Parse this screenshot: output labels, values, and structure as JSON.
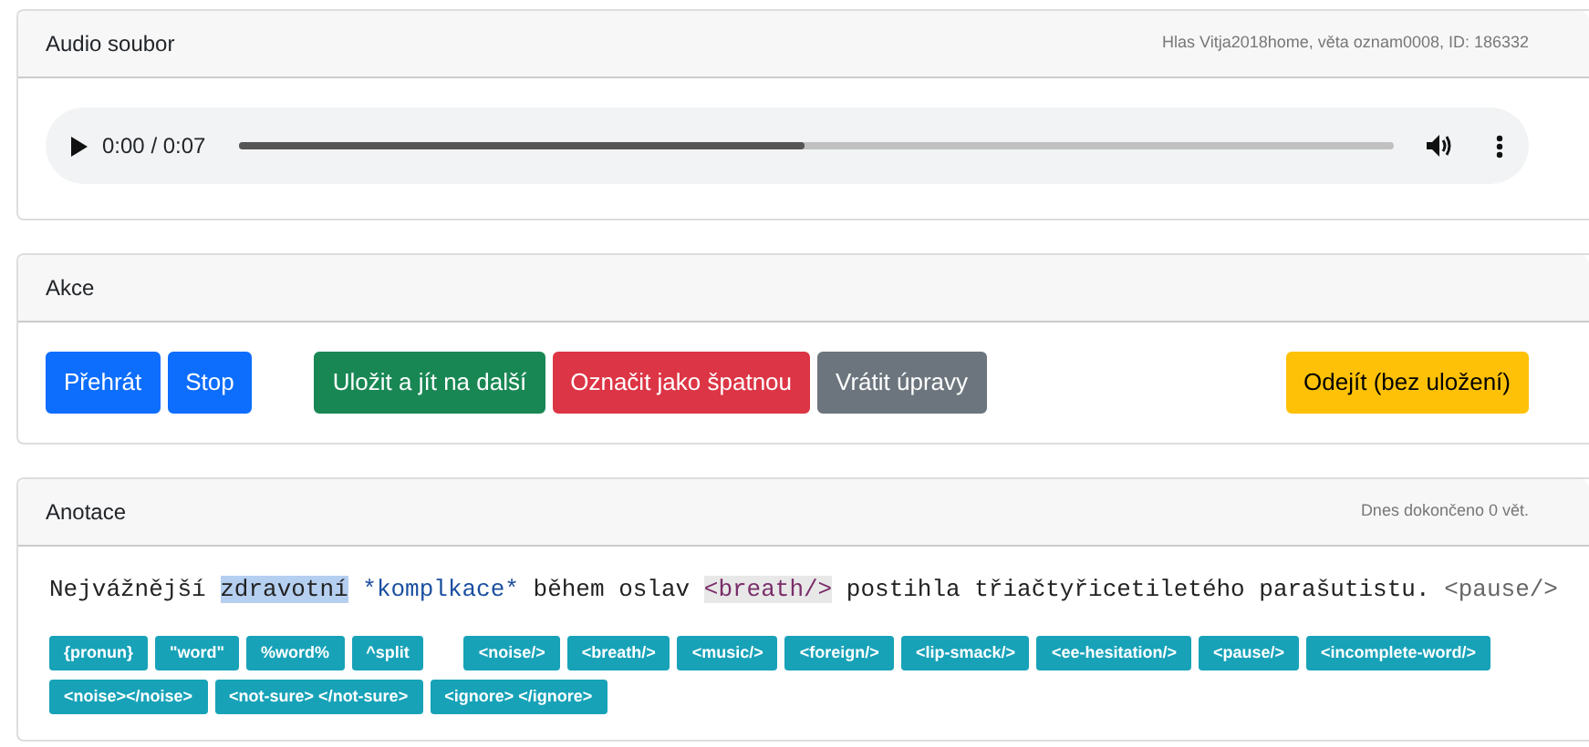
{
  "audio_card": {
    "title": "Audio soubor",
    "meta": "Hlas Vitja2018home, věta oznam0008, ID: 186332",
    "player": {
      "time": "0:00 / 0:07",
      "level": 0.49
    }
  },
  "actions_card": {
    "title": "Akce",
    "button_groups": [
      [
        {
          "label": "Přehrát",
          "kind": "primary"
        },
        {
          "label": "Stop",
          "kind": "primary"
        }
      ],
      [
        {
          "label": "Uložit a jít na další",
          "kind": "success"
        },
        {
          "label": "Označit jako špatnou",
          "kind": "danger"
        },
        {
          "label": "Vrátit úpravy",
          "kind": "secondary"
        }
      ],
      [
        {
          "label": "Odejít (bez uložení)",
          "kind": "warning"
        }
      ]
    ]
  },
  "annotation_card": {
    "title": "Anotace",
    "meta": "Dnes dokončeno 0 vět.",
    "sentence": [
      {
        "text": "Nejvážnější ",
        "kind": "plain"
      },
      {
        "text": "zdravotní",
        "kind": "selected"
      },
      {
        "text": " *komplkace*",
        "kind": "marked"
      },
      {
        "text": " během oslav ",
        "kind": "plain"
      },
      {
        "text": "<breath/>",
        "kind": "tag"
      },
      {
        "text": " postihla třiačtyřicetiletého parašutistu. ",
        "kind": "plain"
      },
      {
        "text": "<pause/>",
        "kind": "pause"
      }
    ],
    "tag_groups": [
      [
        "{pronun}",
        "\"word\"",
        "%word%",
        "^split"
      ],
      [
        "<noise/>",
        "<breath/>",
        "<music/>",
        "<foreign/>",
        "<lip-smack/>",
        "<ee-hesitation/>",
        "<pause/>",
        "<incomplete-word/>",
        "<noise></noise>",
        "<not-sure> </not-sure>",
        "<ignore> </ignore>"
      ]
    ]
  }
}
